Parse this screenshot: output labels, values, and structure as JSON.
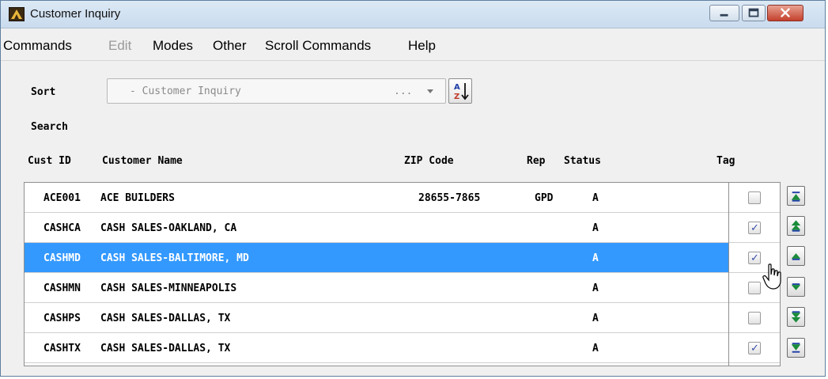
{
  "window": {
    "title": "Customer Inquiry"
  },
  "menu": [
    {
      "label": "Commands",
      "enabled": true
    },
    {
      "label": "Edit",
      "enabled": false
    },
    {
      "label": "Modes",
      "enabled": true
    },
    {
      "label": "Other",
      "enabled": true
    },
    {
      "label": "Scroll Commands",
      "enabled": true
    },
    {
      "label": "Help",
      "enabled": true
    }
  ],
  "sort": {
    "label": "Sort",
    "value": "- Customer Inquiry",
    "ellipsis": "...",
    "az_icon": "sort-az-icon"
  },
  "search": {
    "label": "Search"
  },
  "columns": {
    "cust_id": "Cust ID",
    "name": "Customer Name",
    "zip": "ZIP Code",
    "rep": "Rep",
    "status": "Status",
    "tag": "Tag"
  },
  "rows": [
    {
      "cust_id": "ACE001",
      "name": "ACE BUILDERS",
      "zip": "28655-7865",
      "rep": "GPD",
      "status": "A",
      "tagged": false,
      "selected": false
    },
    {
      "cust_id": "CASHCA",
      "name": "CASH SALES-OAKLAND, CA",
      "zip": "",
      "rep": "",
      "status": "A",
      "tagged": true,
      "selected": false
    },
    {
      "cust_id": "CASHMD",
      "name": "CASH SALES-BALTIMORE, MD",
      "zip": "",
      "rep": "",
      "status": "A",
      "tagged": true,
      "selected": true
    },
    {
      "cust_id": "CASHMN",
      "name": "CASH SALES-MINNEAPOLIS",
      "zip": "",
      "rep": "",
      "status": "A",
      "tagged": false,
      "selected": false
    },
    {
      "cust_id": "CASHPS",
      "name": "CASH SALES-DALLAS, TX",
      "zip": "",
      "rep": "",
      "status": "A",
      "tagged": false,
      "selected": false
    },
    {
      "cust_id": "CASHTX",
      "name": "CASH SALES-DALLAS, TX",
      "zip": "",
      "rep": "",
      "status": "A",
      "tagged": true,
      "selected": false
    }
  ],
  "scroll_buttons": [
    {
      "name": "scroll-top-button",
      "icon": "first-page-icon"
    },
    {
      "name": "scroll-page-up-button",
      "icon": "page-up-icon"
    },
    {
      "name": "scroll-up-button",
      "icon": "line-up-icon"
    },
    {
      "name": "scroll-down-button",
      "icon": "line-down-icon"
    },
    {
      "name": "scroll-page-down-button",
      "icon": "page-down-icon"
    },
    {
      "name": "scroll-bottom-button",
      "icon": "last-page-icon"
    }
  ],
  "colors": {
    "selection": "#3399ff",
    "scroll_arrow": "#1a8c3a",
    "scroll_bar": "#1f3fa8",
    "checkmark": "#3b4ea8"
  }
}
